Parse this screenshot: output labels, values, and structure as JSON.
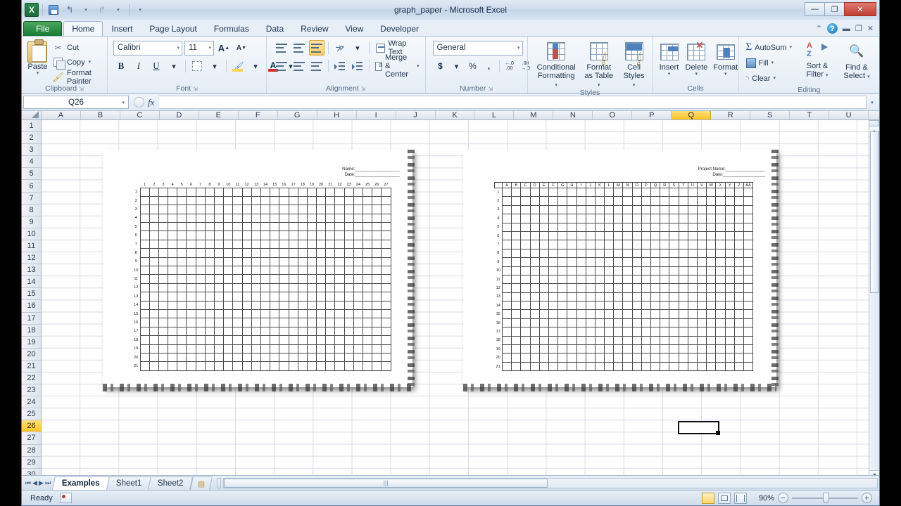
{
  "window": {
    "title": "graph_paper  -  Microsoft Excel",
    "minimize": "—",
    "restore": "❐",
    "close": "✕"
  },
  "quick_access": {
    "logo": "X",
    "save": "save-icon",
    "undo": "↰",
    "redo": "↱",
    "customize": "▾"
  },
  "ribbon": {
    "tabs": [
      {
        "label": "File"
      },
      {
        "label": "Home"
      },
      {
        "label": "Insert"
      },
      {
        "label": "Page Layout"
      },
      {
        "label": "Formulas"
      },
      {
        "label": "Data"
      },
      {
        "label": "Review"
      },
      {
        "label": "View"
      },
      {
        "label": "Developer"
      }
    ],
    "active_tab": "Home",
    "right_controls": {
      "collapse": "⌃",
      "help": "?",
      "minimize_ribbon": "▬",
      "restore_window": "❐",
      "close_window": "✕"
    },
    "groups": {
      "clipboard": {
        "label": "Clipboard",
        "paste": "Paste",
        "cut": "Cut",
        "copy": "Copy",
        "format_painter": "Format Painter",
        "dialog_launcher": "⇲"
      },
      "font": {
        "label": "Font",
        "font_name": "Calibri",
        "font_size": "11",
        "grow_font": "A",
        "shrink_font": "A",
        "bold": "B",
        "italic": "I",
        "underline": "U",
        "borders": "borders-icon",
        "fill_color": "fill-color-icon",
        "font_color": "A",
        "dialog_launcher": "⇲"
      },
      "alignment": {
        "label": "Alignment",
        "wrap_text": "Wrap Text",
        "merge_center": "Merge & Center",
        "dialog_launcher": "⇲"
      },
      "number": {
        "label": "Number",
        "format": "General",
        "accounting": "$",
        "percent": "%",
        "comma": ",",
        "increase_decimal": ".00",
        "decrease_decimal": ".00",
        "dialog_launcher": "⇲"
      },
      "styles": {
        "label": "Styles",
        "conditional_formatting": "Conditional\nFormatting",
        "conditional_formatting_l1": "Conditional",
        "conditional_formatting_l2": "Formatting",
        "format_as_table_l1": "Format",
        "format_as_table_l2": "as Table",
        "cell_styles_l1": "Cell",
        "cell_styles_l2": "Styles"
      },
      "cells": {
        "label": "Cells",
        "insert": "Insert",
        "delete": "Delete",
        "format": "Format"
      },
      "editing": {
        "label": "Editing",
        "autosum": "AutoSum",
        "fill": "Fill",
        "clear": "Clear",
        "sort_filter_l1": "Sort &",
        "sort_filter_l2": "Filter",
        "find_select_l1": "Find &",
        "find_select_l2": "Select"
      }
    }
  },
  "formula_bar": {
    "name_box": "Q26",
    "cancel": "✕",
    "enter": "✓",
    "insert_function": "fx",
    "formula_value": "",
    "expand": "▾"
  },
  "sheet": {
    "column_headers": [
      "A",
      "B",
      "C",
      "D",
      "E",
      "F",
      "G",
      "H",
      "I",
      "J",
      "K",
      "L",
      "M",
      "N",
      "O",
      "P",
      "Q",
      "R",
      "S",
      "T",
      "U"
    ],
    "selected_column": "Q",
    "row_headers": [
      "1",
      "2",
      "3",
      "4",
      "5",
      "6",
      "7",
      "8",
      "9",
      "10",
      "11",
      "12",
      "13",
      "14",
      "15",
      "16",
      "17",
      "18",
      "19",
      "20",
      "21",
      "22",
      "23",
      "24",
      "25",
      "26",
      "27",
      "28",
      "29",
      "30"
    ],
    "selected_row": "26",
    "selected_cell": "Q26"
  },
  "graph_papers": [
    {
      "id": "numbered-grid-paper",
      "header_fields": [
        {
          "label": "Name:",
          "line": "_________________"
        },
        {
          "label": "Date:",
          "line": "_________________"
        }
      ],
      "column_headers": [
        "1",
        "2",
        "3",
        "4",
        "5",
        "6",
        "7",
        "8",
        "9",
        "10",
        "11",
        "12",
        "13",
        "14",
        "15",
        "16",
        "17",
        "18",
        "19",
        "20",
        "21",
        "22",
        "23",
        "24",
        "25",
        "26",
        "27"
      ],
      "row_headers": [
        "1",
        "2",
        "3",
        "4",
        "5",
        "6",
        "7",
        "8",
        "9",
        "10",
        "11",
        "12",
        "13",
        "14",
        "15",
        "16",
        "17",
        "18",
        "19",
        "20",
        "21"
      ]
    },
    {
      "id": "lettered-grid-paper",
      "header_fields": [
        {
          "label": "Project Name:",
          "line": "_______________"
        },
        {
          "label": "Date:",
          "line": "________________"
        }
      ],
      "column_headers": [
        "A",
        "B",
        "C",
        "D",
        "E",
        "F",
        "G",
        "H",
        "I",
        "J",
        "K",
        "L",
        "M",
        "N",
        "O",
        "P",
        "Q",
        "R",
        "S",
        "T",
        "U",
        "V",
        "W",
        "X",
        "Y",
        "Z",
        "AA"
      ],
      "row_headers": [
        "1",
        "2",
        "3",
        "4",
        "5",
        "6",
        "7",
        "8",
        "9",
        "10",
        "11",
        "12",
        "13",
        "14",
        "15",
        "16",
        "17",
        "18",
        "19",
        "20",
        "21"
      ]
    }
  ],
  "sheet_tabs": {
    "first": "⏮",
    "prev": "◀",
    "next": "▶",
    "last": "⏭",
    "tabs": [
      {
        "label": "Examples",
        "active": true
      },
      {
        "label": "Sheet1",
        "active": false
      },
      {
        "label": "Sheet2",
        "active": false
      }
    ],
    "new_sheet": "insert-worksheet-icon"
  },
  "status_bar": {
    "mode": "Ready",
    "macro_record": "record-macro-icon",
    "views": [
      "normal-view",
      "page-layout-view",
      "page-break-preview"
    ],
    "active_view": "normal-view",
    "zoom": "90%",
    "zoom_out": "−",
    "zoom_in": "+"
  }
}
